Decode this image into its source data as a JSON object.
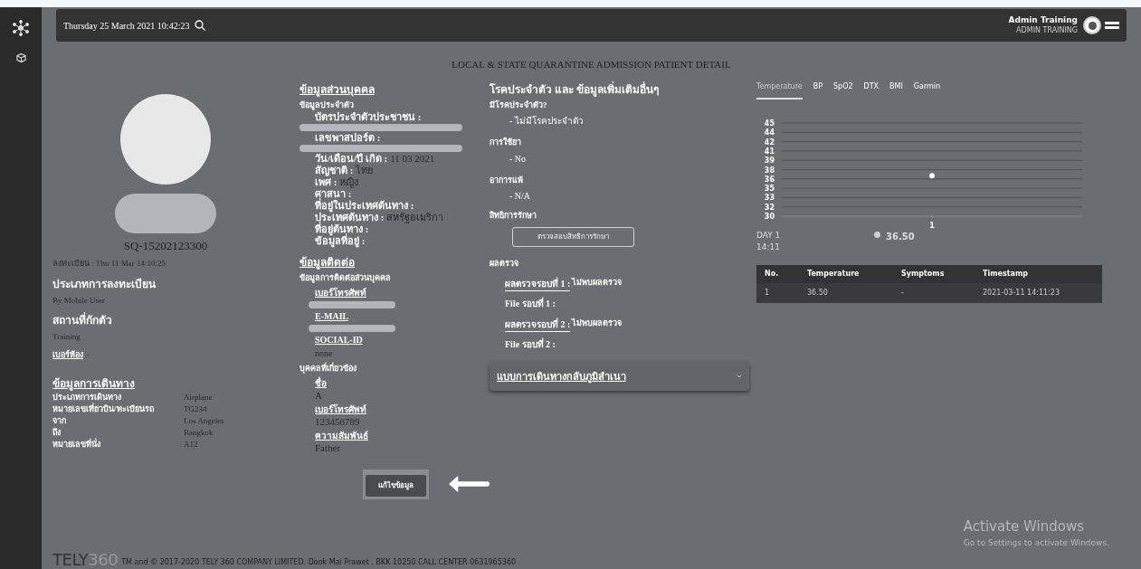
{
  "header": {
    "datetime": "Thursday 25 March 2021 10:42:23",
    "user_name": "Admin Training",
    "user_role": "ADMIN TRAINING"
  },
  "page_title": "LOCAL & STATE QUARANTINE ADMISSION PATIENT DETAIL",
  "profile": {
    "patient_id": "SQ-15202123300",
    "registered": "ลงทะเบียน : Thu 11 Mar 14:10:25",
    "sections": [
      {
        "heading": "ประเภทการลงทะเบียน",
        "value": "By Mobile User"
      },
      {
        "heading": "สถานที่กักตัว",
        "value": "Training"
      }
    ],
    "room_label": "เบอร์ห้อง",
    "room_value": "-"
  },
  "travel": {
    "heading": "ข้อมูลการเดินทาง",
    "rows": [
      {
        "label": "ประเภทการเดินทาง",
        "value": "Airplane"
      },
      {
        "label": "หมายเลขเที่ยวบิน/ทะเบียนรถ",
        "value": "TG234"
      },
      {
        "label": "จาก",
        "value": "Los Angeles"
      },
      {
        "label": "ถึง",
        "value": "Bangkok"
      },
      {
        "label": "หมายเลขที่นั่ง",
        "value": "A12"
      }
    ]
  },
  "personal": {
    "heading": "ข้อมูลส่วนบุคคล",
    "subheading": "ข้อมูลประจำตัว",
    "fields": [
      {
        "label": "บัตรประจำตัวประชาชน :",
        "redacted": true
      },
      {
        "label": "เลขพาสปอร์ต :",
        "redacted": true
      },
      {
        "label": "วัน/เดือน/ปี เกิด :",
        "value": "11 03 2021",
        "redacted": false
      },
      {
        "label": "สัญชาติ :",
        "value": "ไทย",
        "redacted": false
      },
      {
        "label": "เพศ :",
        "value": "หญิง",
        "redacted": false
      },
      {
        "label": "ศาสนา :",
        "redacted": false
      },
      {
        "label": "ที่อยู่ในประเทศต้นทาง :",
        "redacted": false
      },
      {
        "label": "ประเทศต้นทาง :",
        "value": "สหรัฐอเมริกา",
        "redacted": false
      },
      {
        "label": "ที่อยู่ต้นทาง :",
        "redacted": false
      },
      {
        "label": "ข้อมูลที่อยู่ :",
        "redacted": false
      }
    ]
  },
  "contact": {
    "heading": "ข้อมูลติดต่อ",
    "subheading": "ข้อมูลการติดต่อส่วนบุคคล",
    "fields": [
      {
        "label": "เบอร์โทรศัพท์",
        "redacted": true
      },
      {
        "label": "E-MAIL",
        "redacted": true
      },
      {
        "label": "SOCIAL-ID",
        "value": "none",
        "redacted": false
      }
    ],
    "related_heading": "บุคคลที่เกี่ยวข้อง",
    "related": [
      {
        "label": "ชื่อ",
        "value": "A"
      },
      {
        "label": "เบอร์โทรศัพท์",
        "value": "123456789"
      },
      {
        "label": "ความสัมพันธ์",
        "value": "Father"
      }
    ]
  },
  "edit_button": "แก้ไขข้อมูล",
  "medical": {
    "heading": "โรคประจำตัว และ ข้อมูลเพิ่มเติมอื่นๆ",
    "items": [
      {
        "label": "มีโรคประจำตัว?",
        "value": "- ไม่มีโรคประจำตัว"
      },
      {
        "label": "การใช้ยา",
        "value": "- No"
      },
      {
        "label": "อาการแพ้",
        "value": "- N/A"
      }
    ],
    "rights_label": "สิทธิการรักษา",
    "rights_button": "ตรวจสอบสิทธิการรักษา",
    "results_heading": "ผลตรวจ",
    "results": [
      {
        "label": "ผลตรวจรอบที่ 1 :",
        "value": "ไม่พบผลตรวจ",
        "file": "File รอบที่ 1 :"
      },
      {
        "label": "ผลตรวจรอบที่ 2 :",
        "value": "ไม่พบผลตรวจ",
        "file": "File รอบที่ 2 :"
      }
    ],
    "accordion": {
      "title": "แบบการเดินทางกลับภูมิลำเนา",
      "expanded": false
    }
  },
  "vitals": {
    "tabs": [
      {
        "label": "Temperature",
        "selected": true
      },
      {
        "label": "BP",
        "selected": false
      },
      {
        "label": "SpO2",
        "selected": false
      },
      {
        "label": "DTX",
        "selected": false
      },
      {
        "label": "BMI",
        "selected": false
      },
      {
        "label": "Garmin",
        "selected": false
      }
    ],
    "chart_data": {
      "type": "line",
      "categories": [
        "1"
      ],
      "series": [
        {
          "color": "#ffffff",
          "marker": true,
          "values": [
            36.5
          ]
        }
      ],
      "grid": true,
      "ylim": [
        30,
        45
      ],
      "yticks": [
        30,
        {
          "value": 31.5,
          "label": "32"
        },
        33,
        {
          "value": 34.5,
          "label": "35"
        },
        36,
        {
          "value": 37.5,
          "label": "38"
        },
        39,
        {
          "value": 40.5,
          "label": "41"
        },
        42,
        {
          "value": 43.5,
          "label": "44"
        },
        45
      ]
    },
    "legend": {
      "day": "DAY 1",
      "time": "14:11",
      "value": "36.50"
    },
    "table": {
      "columns": [
        "No.",
        "Temperature",
        "Symptoms",
        "Timestamp"
      ],
      "rows": [
        [
          "1",
          "36.50",
          "-",
          "2021-03-11 14:11:23"
        ]
      ]
    }
  },
  "os_notice": {
    "title": "Activate Windows",
    "subtitle": "Go to Settings to activate Windows."
  },
  "footer": {
    "logo_main": "TELY",
    "logo_accent": "360",
    "text": "TM and © 2017-2020 TELY 360 COMPANY LIMITED. Dook Mai Prawet . BKK 10250 CALL CENTER 0631965360"
  }
}
